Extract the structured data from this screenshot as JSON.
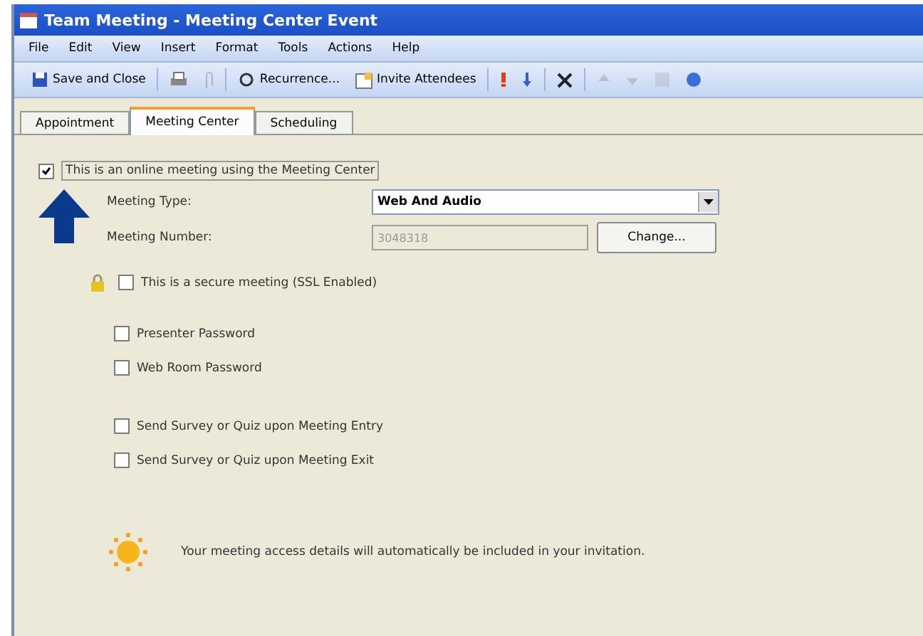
{
  "window": {
    "title": "Team Meeting - Meeting Center Event"
  },
  "menu": [
    "File",
    "Edit",
    "View",
    "Insert",
    "Format",
    "Tools",
    "Actions",
    "Help"
  ],
  "toolbar": [
    {
      "kind": "text",
      "label": "Save and Close"
    },
    {
      "kind": "icon"
    },
    {
      "kind": "icon",
      "disabled": true
    },
    {
      "kind": "text",
      "label": "Recurrence..."
    },
    {
      "kind": "text",
      "label": "Invite Attendees"
    },
    {
      "kind": "icon"
    },
    {
      "kind": "icon"
    },
    {
      "kind": "icon"
    },
    {
      "kind": "icon",
      "disabled": true
    },
    {
      "kind": "icon",
      "disabled": true
    },
    {
      "kind": "icon",
      "disabled": true
    },
    {
      "kind": "icon"
    }
  ],
  "tabs": [
    {
      "label": "Appointment",
      "selected": false
    },
    {
      "label": "Meeting Center",
      "selected": true
    },
    {
      "label": "Scheduling",
      "selected": false
    }
  ],
  "online_meeting": {
    "label": "This is an online meeting using the Meeting Center",
    "checked": true
  },
  "meeting_type": {
    "label": "Meeting Type:",
    "value": "Web And Audio"
  },
  "meeting_number": {
    "label": "Meeting Number:",
    "value": "3048318",
    "disabled": true,
    "button": "Change..."
  },
  "secure": {
    "label": "This is a secure meeting  (SSL Enabled)",
    "checked": false
  },
  "password_options": [
    {
      "label": "Presenter Password",
      "checked": false
    },
    {
      "label": "Web Room Password",
      "checked": false
    }
  ],
  "survey_options": [
    {
      "label": "Send Survey or Quiz upon Meeting Entry",
      "checked": false
    },
    {
      "label": "Send Survey or Quiz upon Meeting Exit",
      "checked": false
    }
  ],
  "info": "Your meeting access details will automatically be included in your invitation."
}
